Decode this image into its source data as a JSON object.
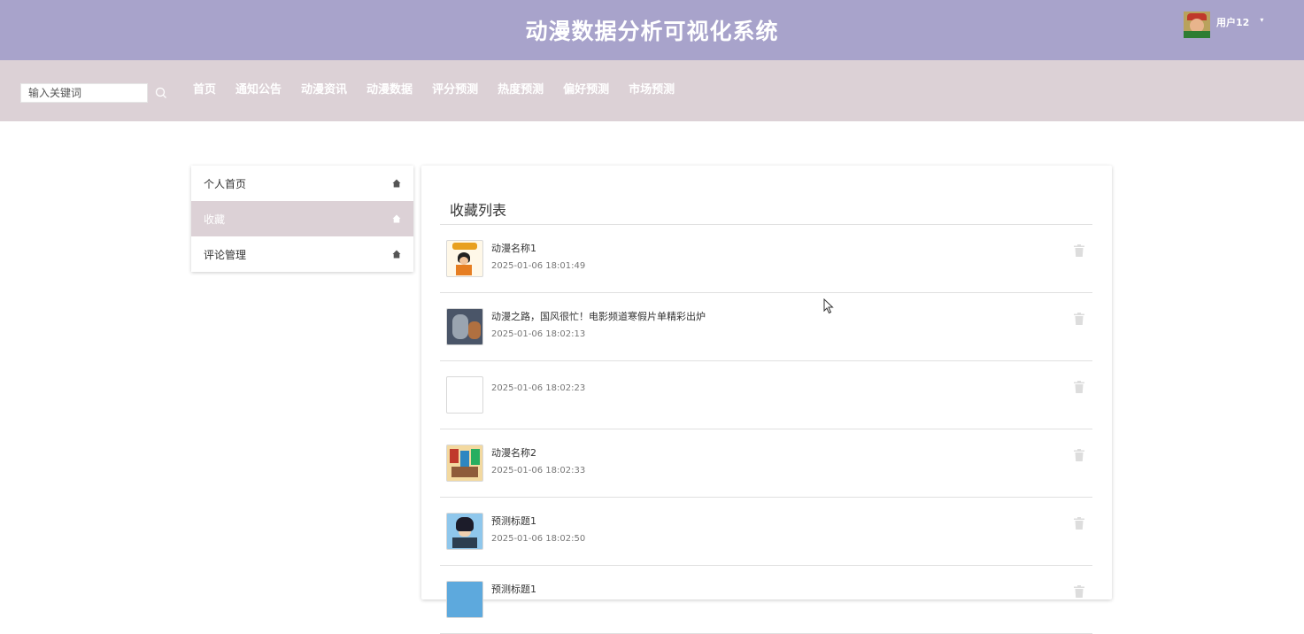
{
  "header": {
    "title": "动漫数据分析可视化系统",
    "user_name": "用户12",
    "caret": "▾"
  },
  "nav": {
    "search_placeholder": "输入关键词",
    "items": [
      "首页",
      "通知公告",
      "动漫资讯",
      "动漫数据",
      "评分预测",
      "热度预测",
      "偏好预测",
      "市场预测"
    ]
  },
  "sidebar": {
    "items": [
      {
        "label": "个人首页",
        "active": false
      },
      {
        "label": "收藏",
        "active": true
      },
      {
        "label": "评论管理",
        "active": false
      }
    ]
  },
  "main": {
    "title": "收藏列表",
    "favorites": [
      {
        "name": "动漫名称1",
        "time": "2025-01-06 18:01:49"
      },
      {
        "name": "动漫之路，国风很忙！电影频道寒假片单精彩出炉",
        "time": "2025-01-06 18:02:13"
      },
      {
        "name": "",
        "time": "2025-01-06 18:02:23"
      },
      {
        "name": "动漫名称2",
        "time": "2025-01-06 18:02:33"
      },
      {
        "name": "预测标题1",
        "time": "2025-01-06 18:02:50"
      },
      {
        "name": "预测标题1",
        "time": ""
      }
    ]
  },
  "colors": {
    "banner": "#a8a3cb",
    "navbar": "#dcd1d6",
    "active_sidebar": "#dcd1d6"
  }
}
